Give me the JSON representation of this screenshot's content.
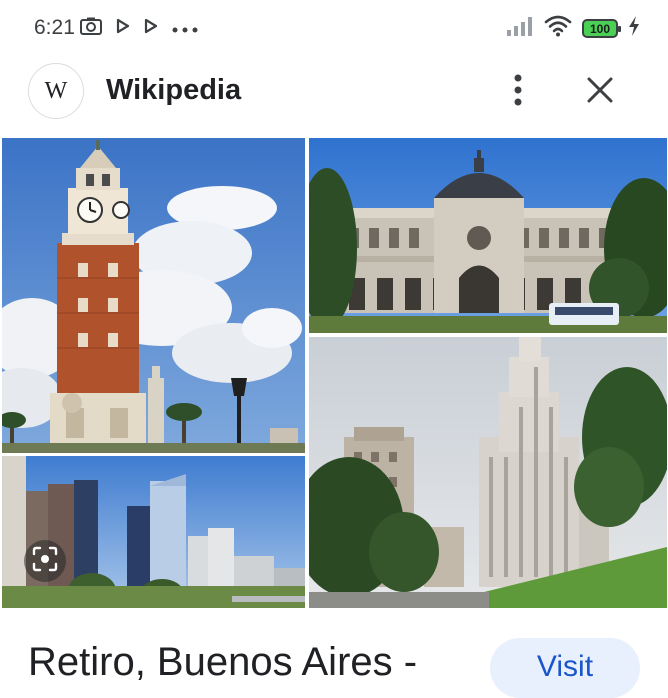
{
  "status_bar": {
    "time": "6:21",
    "battery": "100",
    "icons": [
      "camera-icon",
      "play-icon",
      "play-icon",
      "more-dots-icon",
      "signal-icon",
      "wifi-icon",
      "battery-icon",
      "charging-icon"
    ]
  },
  "header": {
    "logo_letter": "W",
    "title": "Wikipedia"
  },
  "gallery": {
    "images": [
      "clock-tower-photo",
      "station-building-photo",
      "city-skyline-photo",
      "kavanagh-building-photo"
    ]
  },
  "result": {
    "title": "Retiro, Buenos Aires -",
    "visit_label": "Visit"
  },
  "colors": {
    "accent": "#1a56c9",
    "visit_bg": "#e8f0fe",
    "battery": "#4ad155"
  }
}
